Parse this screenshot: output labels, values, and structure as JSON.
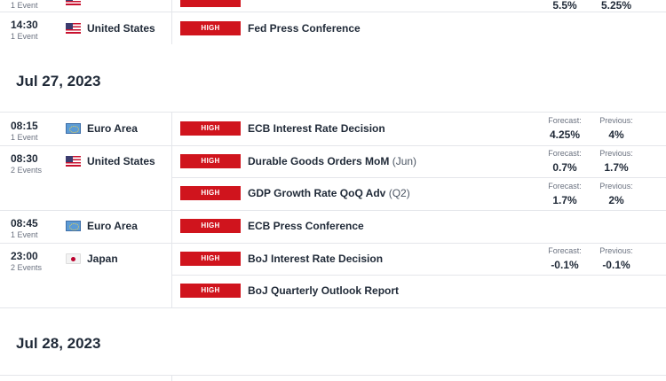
{
  "top_partial": {
    "count": "1 Event",
    "forecast_value": "5.5%",
    "previous_value": "5.25%"
  },
  "jul26_tail": {
    "time": "14:30",
    "count": "1 Event",
    "country": "United States",
    "flag": "us-flag-icon",
    "impact": "HIGH",
    "event": "Fed Press Conference"
  },
  "day_jul27": {
    "date": "Jul 27, 2023",
    "stat_labels": {
      "forecast": "Forecast:",
      "previous": "Previous:"
    },
    "rows": [
      {
        "time": "08:15",
        "count": "1 Event",
        "country": "Euro Area",
        "impact": "HIGH",
        "event": "ECB Interest Rate Decision",
        "period": "",
        "forecast": "4.25%",
        "previous": "4%"
      },
      {
        "time": "08:30",
        "count": "2 Events",
        "country": "United States",
        "impact": "HIGH",
        "event": "Durable Goods Orders MoM",
        "period": "(Jun)",
        "forecast": "0.7%",
        "previous": "1.7%"
      },
      {
        "time": "",
        "count": "",
        "country": "",
        "impact": "HIGH",
        "event": "GDP Growth Rate QoQ Adv",
        "period": "(Q2)",
        "forecast": "1.7%",
        "previous": "2%"
      },
      {
        "time": "08:45",
        "count": "1 Event",
        "country": "Euro Area",
        "impact": "HIGH",
        "event": "ECB Press Conference",
        "period": "",
        "forecast": "",
        "previous": ""
      },
      {
        "time": "23:00",
        "count": "2 Events",
        "country": "Japan",
        "impact": "HIGH",
        "event": "BoJ Interest Rate Decision",
        "period": "",
        "forecast": "-0.1%",
        "previous": "-0.1%"
      },
      {
        "time": "",
        "count": "",
        "country": "",
        "impact": "HIGH",
        "event": "BoJ Quarterly Outlook Report",
        "period": "",
        "forecast": "",
        "previous": ""
      }
    ]
  },
  "day_jul28": {
    "date": "Jul 28, 2023"
  },
  "colors": {
    "impact_high": "#d0141d",
    "divider": "#e4e6ea",
    "text_primary": "#1f2937",
    "text_muted": "#6b7280"
  }
}
